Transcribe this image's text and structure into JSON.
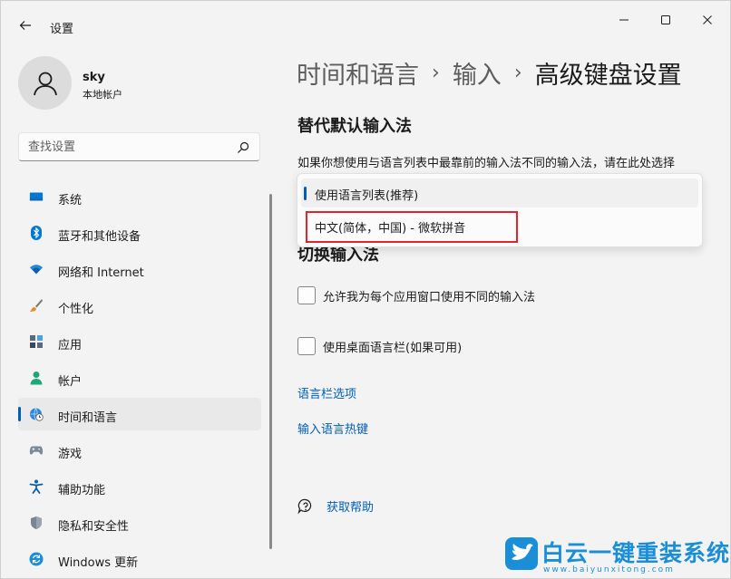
{
  "window": {
    "title": "设置",
    "controls": {
      "minimize": "minimize",
      "maximize": "maximize",
      "close": "close"
    }
  },
  "user": {
    "name": "sky",
    "account_type": "本地帐户"
  },
  "search": {
    "placeholder": "查找设置"
  },
  "sidebar": {
    "items": [
      {
        "label": "系统",
        "icon": "monitor-icon",
        "active": false
      },
      {
        "label": "蓝牙和其他设备",
        "icon": "bluetooth-icon",
        "active": false
      },
      {
        "label": "网络和 Internet",
        "icon": "wifi-icon",
        "active": false
      },
      {
        "label": "个性化",
        "icon": "brush-icon",
        "active": false
      },
      {
        "label": "应用",
        "icon": "apps-icon",
        "active": false
      },
      {
        "label": "帐户",
        "icon": "person-icon",
        "active": false
      },
      {
        "label": "时间和语言",
        "icon": "globe-clock-icon",
        "active": true
      },
      {
        "label": "游戏",
        "icon": "gamepad-icon",
        "active": false
      },
      {
        "label": "辅助功能",
        "icon": "accessibility-icon",
        "active": false
      },
      {
        "label": "隐私和安全性",
        "icon": "shield-icon",
        "active": false
      },
      {
        "label": "Windows 更新",
        "icon": "update-icon",
        "active": false
      }
    ]
  },
  "breadcrumb": [
    "时间和语言",
    "输入",
    "高级键盘设置"
  ],
  "breadcrumb_separator": "›",
  "override_section": {
    "title": "替代默认输入法",
    "description": "如果你想使用与语言列表中最靠前的输入法不同的输入法，请在此处选择",
    "options": [
      "使用语言列表(推荐)",
      "中文(简体，中国) - 微软拼音"
    ],
    "selected_index": 0
  },
  "switch_section": {
    "title": "切换输入法",
    "checkboxes": [
      {
        "label": "允许我为每个应用窗口使用不同的输入法",
        "checked": false
      },
      {
        "label": "使用桌面语言栏(如果可用)",
        "checked": false
      }
    ]
  },
  "links": {
    "language_bar": "语言栏选项",
    "hotkeys": "输入语言热键"
  },
  "help": {
    "label": "获取帮助"
  },
  "watermark": {
    "text": "白云一键重装系统",
    "url": "www.baiyunxitong.com"
  },
  "colors": {
    "accent": "#005fb8",
    "highlight": "#e3242b",
    "background": "#f3f3f3",
    "watermark": "#1a8fd8"
  }
}
